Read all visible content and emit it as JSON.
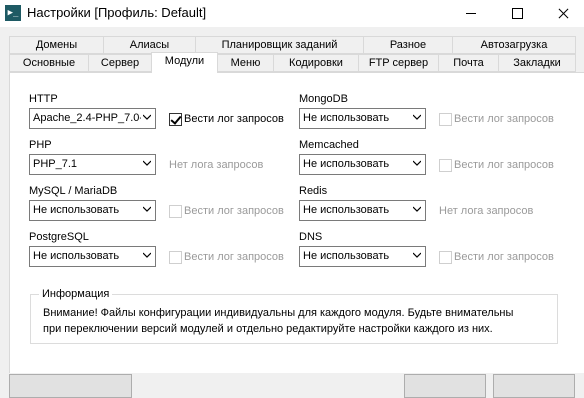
{
  "window": {
    "title": "Настройки [Профиль: Default]",
    "app_icon_glyph": "▶_"
  },
  "tabs_row1": [
    "Домены",
    "Алиасы",
    "Планировщик заданий",
    "Разное",
    "Автозагрузка"
  ],
  "tabs_row2": [
    "Основные",
    "Сервер",
    "Модули",
    "Меню",
    "Кодировки",
    "FTP сервер",
    "Почта",
    "Закладки"
  ],
  "active_tab": "Модули",
  "modules": {
    "http": {
      "label": "HTTP",
      "value": "Apache_2.4-PHP_7.0-",
      "log_label": "Вести лог запросов",
      "log_checked": true
    },
    "php": {
      "label": "PHP",
      "value": "PHP_7.1",
      "log_label": "Нет лога запросов"
    },
    "mysql": {
      "label": "MySQL / MariaDB",
      "value": "Не использовать",
      "log_label": "Вести лог запросов",
      "log_checked": false
    },
    "postgre": {
      "label": "PostgreSQL",
      "value": "Не использовать",
      "log_label": "Вести лог запросов",
      "log_checked": false
    },
    "mongodb": {
      "label": "MongoDB",
      "value": "Не использовать",
      "log_label": "Вести лог запросов",
      "log_checked": false
    },
    "memcached": {
      "label": "Memcached",
      "value": "Не использовать",
      "log_label": "Вести лог запросов",
      "log_checked": false
    },
    "redis": {
      "label": "Redis",
      "value": "Не использовать",
      "log_label": "Нет лога запросов"
    },
    "dns": {
      "label": "DNS",
      "value": "Не использовать",
      "log_label": "Вести лог запросов",
      "log_checked": false
    }
  },
  "info": {
    "title": "Информация",
    "line1": "Внимание! Файлы конфигурации индивидуальны для каждого модуля. Будьте внимательны",
    "line2": "при переключении версий модулей и отдельно редактируйте настройки каждого из них."
  }
}
